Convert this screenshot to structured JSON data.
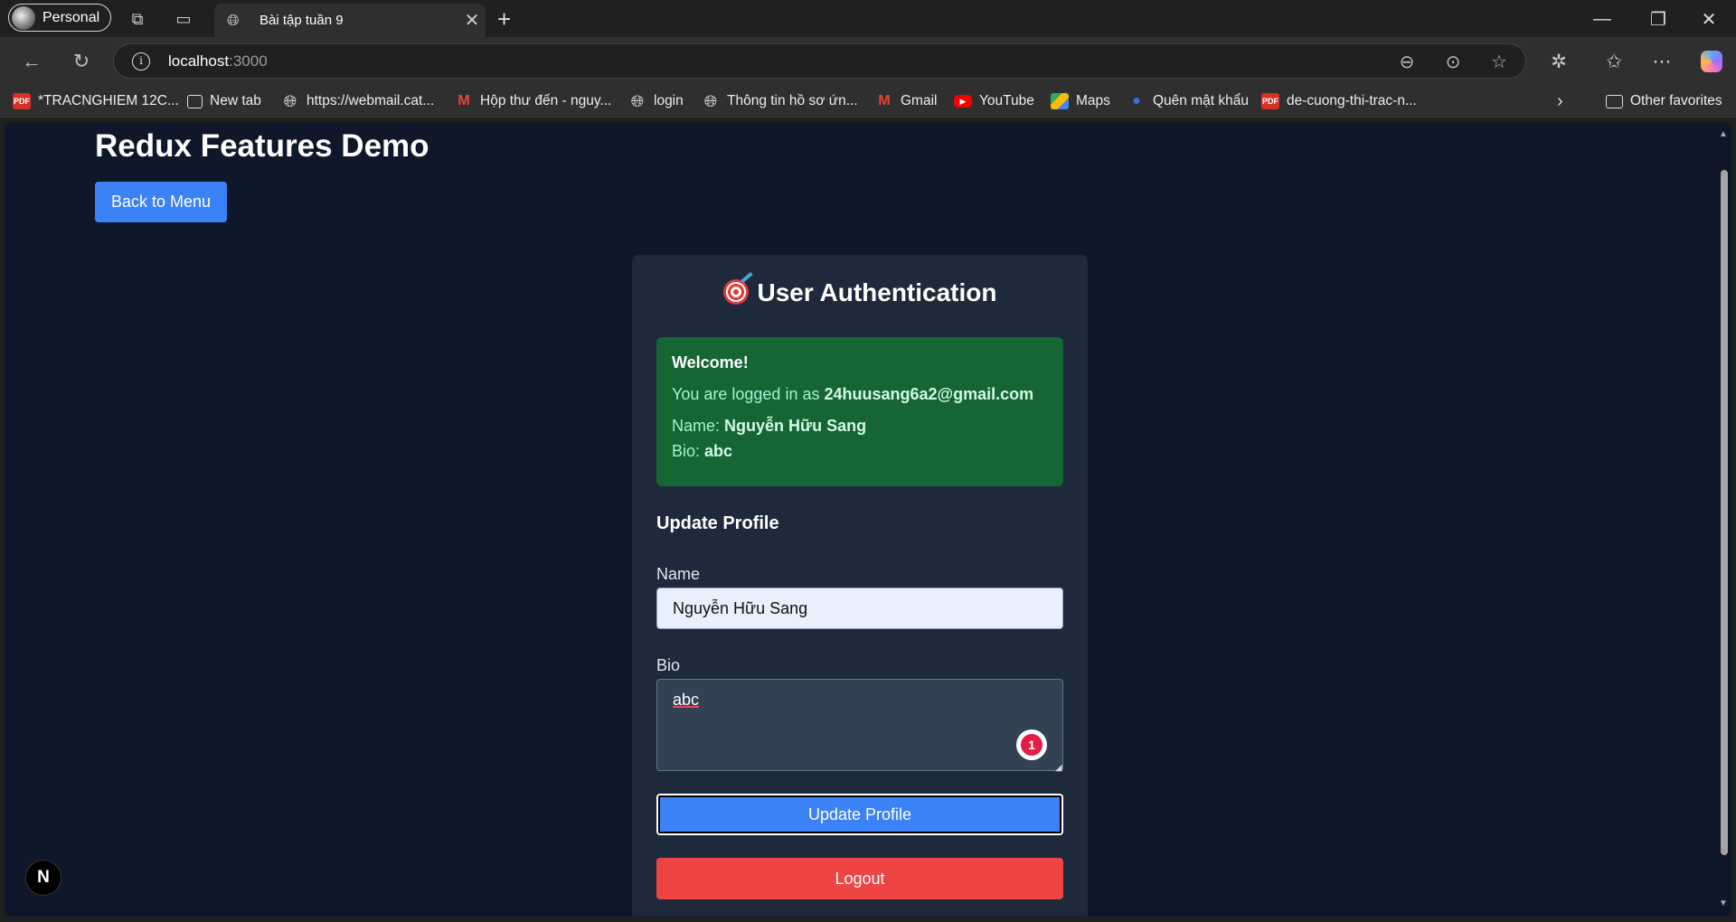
{
  "browser": {
    "profile_label": "Personal",
    "tab_title": "Bài tập tuần 9",
    "url_host": "localhost",
    "url_port": ":3000"
  },
  "bookmarks": [
    {
      "label": "*TRACNGHIEM 12C...",
      "icon": "pdf-icon"
    },
    {
      "label": "New tab",
      "icon": "new-tab-icon"
    },
    {
      "label": "https://webmail.cat...",
      "icon": "globe-icon"
    },
    {
      "label": "Hộp thư đến - nguy...",
      "icon": "gmail-icon"
    },
    {
      "label": "login",
      "icon": "globe-icon"
    },
    {
      "label": "Thông tin hồ sơ ứn...",
      "icon": "globe-icon"
    },
    {
      "label": "Gmail",
      "icon": "gmail-icon"
    },
    {
      "label": "YouTube",
      "icon": "youtube-icon"
    },
    {
      "label": "Maps",
      "icon": "maps-icon"
    },
    {
      "label": "Quên mật khẩu",
      "icon": "key-icon"
    },
    {
      "label": "de-cuong-thi-trac-n...",
      "icon": "pdf-icon"
    }
  ],
  "other_favorites": "Other favorites",
  "page": {
    "title": "Redux Features Demo",
    "back_button": "Back to Menu",
    "card_title": "User Authentication",
    "welcome": {
      "heading": "Welcome!",
      "logged_in_prefix": "You are logged in as ",
      "email": "24huusang6a2@gmail.com",
      "name_prefix": "Name: ",
      "name": "Nguyễn Hữu Sang",
      "bio_prefix": "Bio: ",
      "bio": "abc"
    },
    "update_section_title": "Update Profile",
    "name_label": "Name",
    "name_value": "Nguyễn Hữu Sang",
    "bio_label": "Bio",
    "bio_value": "abc",
    "grammar_count": "1",
    "update_button": "Update Profile",
    "logout_button": "Logout",
    "next_badge": "N"
  },
  "colors": {
    "page_bg": "#0f172a",
    "card_bg": "#1e293b",
    "primary": "#3b82f6",
    "danger": "#ef4444",
    "success_bg": "#166534"
  }
}
